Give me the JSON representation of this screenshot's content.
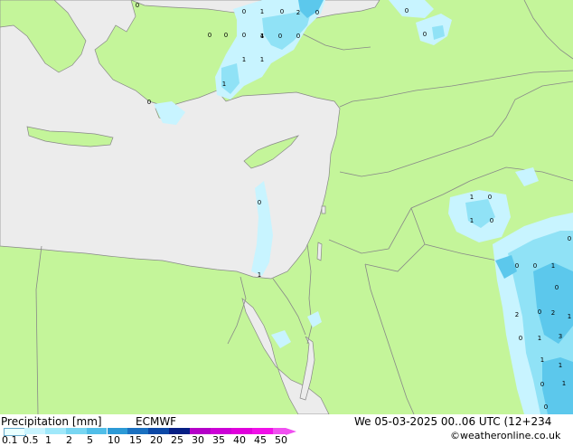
{
  "footer": {
    "title": "Precipitation [mm]",
    "model": "ECMWF",
    "datetime": "We 05-03-2025 00..06 UTC (12+234",
    "credit": "©weatheronline.co.uk"
  },
  "legend": {
    "ticks": [
      "0.1",
      "0.5",
      "1",
      "2",
      "5",
      "10",
      "15",
      "20",
      "25",
      "30",
      "35",
      "40",
      "45",
      "50"
    ],
    "colors": [
      "#e8ffff",
      "#c8f4ff",
      "#a0e8fa",
      "#78d6f2",
      "#50bee8",
      "#2c9ad6",
      "#1a70c0",
      "#0c48a6",
      "#061e84",
      "#b400c8",
      "#cc00d6",
      "#e000dc",
      "#f010e8",
      "#f050f0"
    ]
  },
  "colors": {
    "land": "#c4f59a",
    "sea": "#ececec",
    "border": "#888888",
    "precip_light": "#c8f4ff",
    "precip_mid": "#90e2f6",
    "precip_strong": "#5cc8ec"
  },
  "map_labels": [
    "0",
    "1",
    "0",
    "2",
    "0",
    "0",
    "0",
    "0",
    "1",
    "0",
    "0",
    "4",
    "0",
    "1",
    "1",
    "1",
    "0",
    "0",
    "0",
    "0",
    "1",
    "1",
    "0",
    "1",
    "0",
    "0",
    "0",
    "1",
    "0",
    "2",
    "0",
    "2",
    "1",
    "0",
    "1",
    "3",
    "1",
    "1",
    "0",
    "1",
    "0",
    "0"
  ]
}
